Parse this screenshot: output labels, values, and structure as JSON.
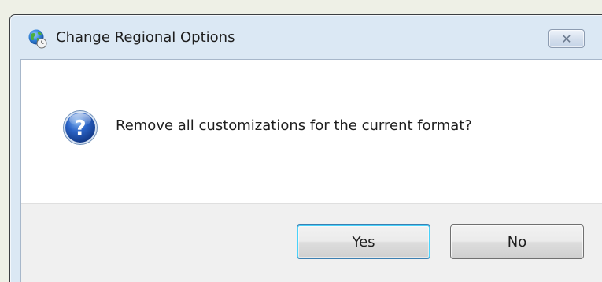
{
  "window": {
    "title": "Change Regional Options",
    "app_icon": "globe-clock-icon",
    "close_label": "✕"
  },
  "message": {
    "icon": "question-icon",
    "text": "Remove all customizations for the current format?"
  },
  "buttons": {
    "yes_label": "Yes",
    "no_label": "No"
  },
  "colors": {
    "frame": "#dbe8f4",
    "button_panel": "#f0f0f0",
    "default_button_border": "#3c7fb1",
    "question_icon": "#1b4fa8"
  }
}
